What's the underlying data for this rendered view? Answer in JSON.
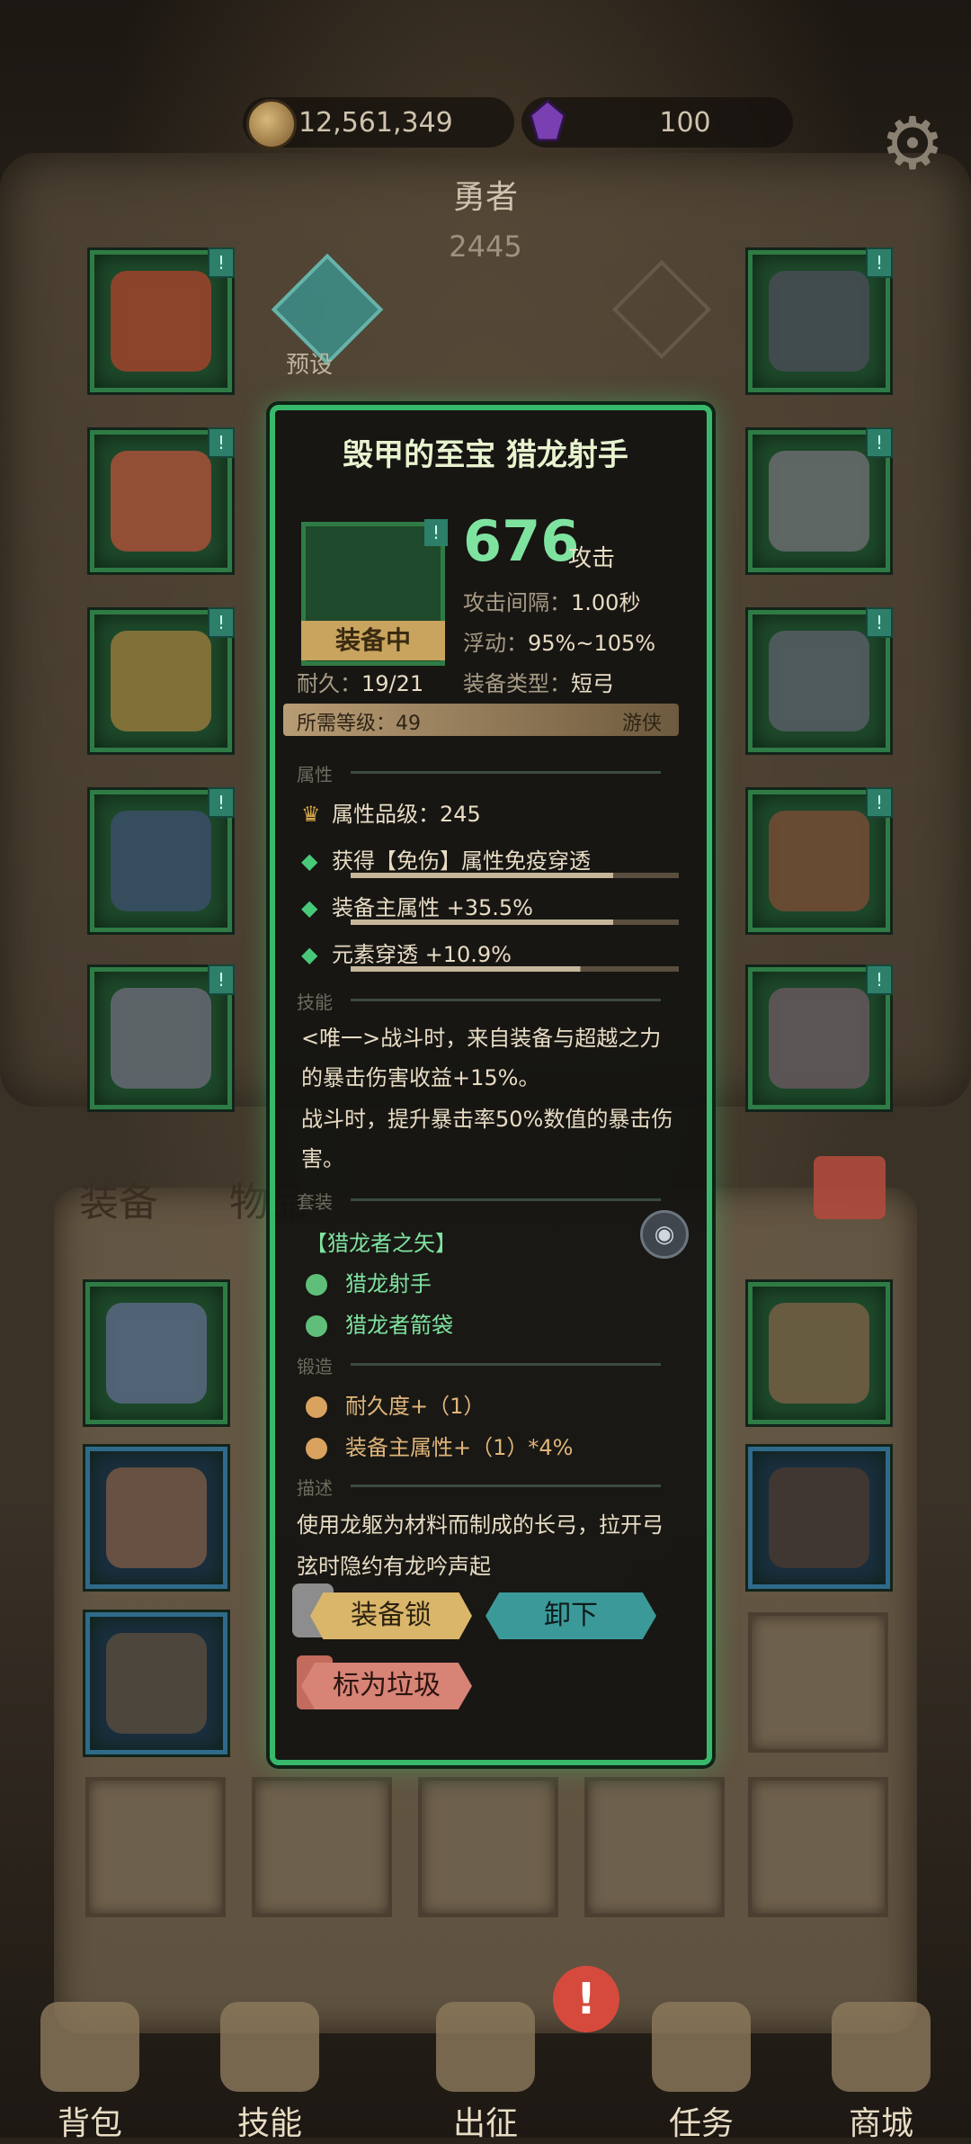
{
  "top_bar": {
    "coins": "12,561,349",
    "gems": "100",
    "settings_icon": "gear-icon"
  },
  "hero": {
    "title": "勇者",
    "level": "2445",
    "preset_label": "预设"
  },
  "tabs": {
    "equipment": "装备",
    "items": "物品"
  },
  "item": {
    "name": "毁甲的至宝 猎龙射手",
    "equipped_label": "装备中",
    "attack_value": "676",
    "attack_label": "攻击",
    "interval_label": "攻击间隔：",
    "interval_value": "1.00秒",
    "float_label": "浮动：",
    "float_value": "95%~105%",
    "durability_label": "耐久：",
    "durability_value": "19/21",
    "type_label": "装备类型：",
    "type_value": "短弓",
    "req_level": "所需等级：49",
    "req_class": "游侠",
    "section_attr": "属性",
    "attr_grade": "属性品级：245",
    "attrs": [
      "获得【免伤】属性免疫穿透",
      "装备主属性 +35.5%",
      "元素穿透 +10.9%"
    ],
    "attr_fill": [
      0.8,
      0.8,
      0.7
    ],
    "section_skill": "技能",
    "skill_1": "<唯一>战斗时，来自装备与超越之力的暴击伤害收益+15%。",
    "skill_2": "战斗时，提升暴击率50%数值的暴击伤害。",
    "section_set": "套装",
    "set_name": "【猎龙者之矢】",
    "set_items": [
      "猎龙射手",
      "猎龙者箭袋"
    ],
    "section_forge": "锻造",
    "forge_items": [
      "耐久度+（1）",
      "装备主属性+（1）*4%"
    ],
    "section_desc": "描述",
    "description": "使用龙躯为材料而制成的长弓，拉开弓弦时隐约有龙吟声起",
    "btn_lock": "装备锁",
    "btn_unequip": "卸下",
    "btn_trash": "标为垃圾"
  },
  "nav": [
    "背包",
    "技能",
    "出征",
    "任务",
    "商城"
  ],
  "colors": {
    "green_frame": "#38b86a",
    "gold": "#c8a45e",
    "teal": "#3b9a99"
  }
}
